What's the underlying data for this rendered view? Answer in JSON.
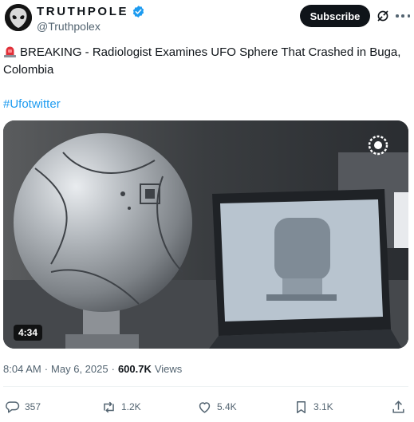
{
  "author": {
    "display_name": "TRUTHPOLE",
    "handle": "@Truthpolex",
    "avatar_icon": "alien-head-icon",
    "verified_icon": "verified-badge-icon"
  },
  "header": {
    "subscribe_label": "Subscribe",
    "grok_icon": "grok-icon",
    "more_icon": "more-icon"
  },
  "tweet": {
    "siren_icon": "rotating-light-emoji",
    "text": "BREAKING - Radiologist Examines UFO Sphere That Crashed in Buga, Colombia",
    "hashtag": "#Ufotwitter"
  },
  "media": {
    "type": "video",
    "duration": "4:34",
    "watermark_icon": "watermark-logo-icon"
  },
  "meta": {
    "time": "8:04 AM",
    "separator": "·",
    "date": "May 6, 2025",
    "views_count": "600.7K",
    "views_label": "Views"
  },
  "actions": {
    "replies": "357",
    "reposts": "1.2K",
    "likes": "5.4K",
    "bookmarks": "3.1K"
  },
  "colors": {
    "text": "#0f1419",
    "secondary": "#536471",
    "link": "#1d9bf0",
    "verified": "#1d9bf0",
    "button_bg": "#0f1419"
  }
}
